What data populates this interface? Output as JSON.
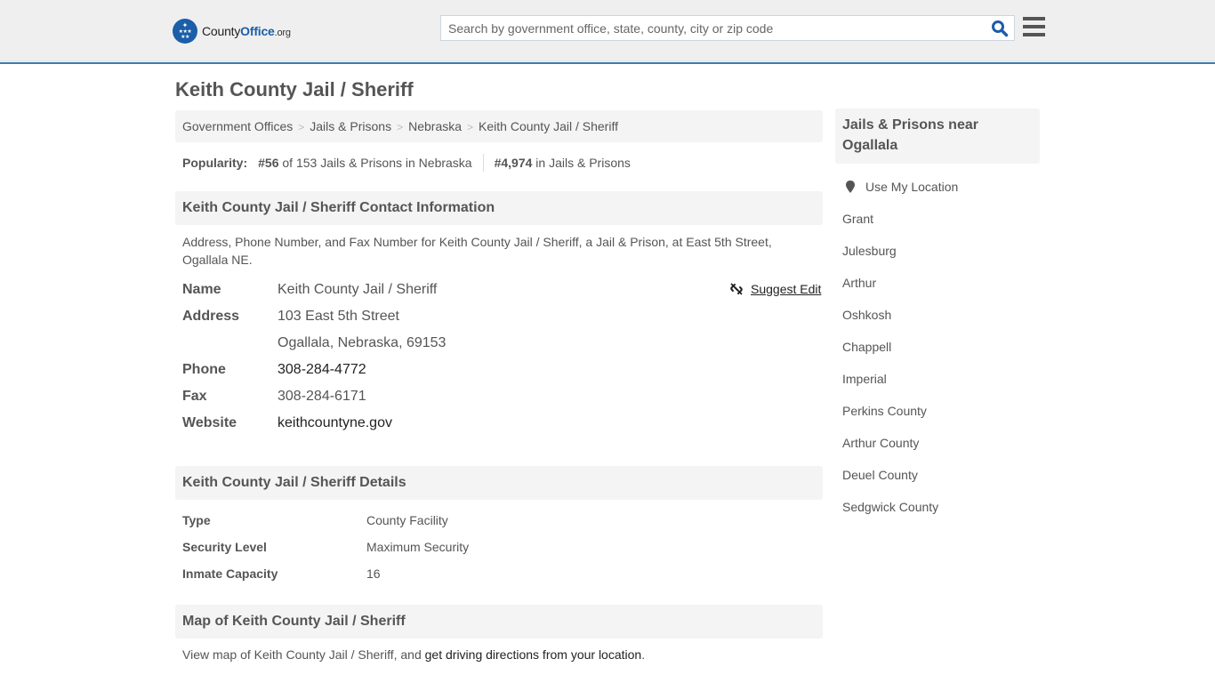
{
  "header": {
    "logo": {
      "county": "County",
      "office": "Office",
      "org": ".org"
    },
    "search_placeholder": "Search by government office, state, county, city or zip code",
    "search_value": "",
    "icons": {
      "search": "search-icon",
      "menu": "hamburger-menu-icon",
      "logo": "eagle-stars-badge-icon"
    },
    "brand_color": "#1b5ea9",
    "accent_border_color": "#3d7eaa"
  },
  "page_title": "Keith County Jail / Sheriff",
  "breadcrumb": [
    {
      "label": "Government Offices"
    },
    {
      "label": "Jails & Prisons"
    },
    {
      "label": "Nebraska"
    },
    {
      "label": "Keith County Jail / Sheriff"
    }
  ],
  "popularity": {
    "label": "Popularity:",
    "state_rank": "#56",
    "state_rank_text": " of 153 Jails & Prisons in Nebraska",
    "national_rank": "#4,974",
    "national_rank_text": " in Jails & Prisons"
  },
  "contact_section": {
    "heading": "Keith County Jail / Sheriff Contact Information",
    "description": "Address, Phone Number, and Fax Number for Keith County Jail / Sheriff, a Jail & Prison, at East 5th Street, Ogallala NE.",
    "suggest_edit": "Suggest Edit",
    "rows": {
      "name": {
        "label": "Name",
        "value": "Keith County Jail / Sheriff"
      },
      "address": {
        "label": "Address",
        "line1": "103 East 5th Street",
        "line2": "Ogallala, Nebraska, 69153"
      },
      "phone": {
        "label": "Phone",
        "value": "308-284-4772"
      },
      "fax": {
        "label": "Fax",
        "value": "308-284-6171"
      },
      "website": {
        "label": "Website",
        "value": "keithcountyne.gov"
      }
    }
  },
  "details_section": {
    "heading": "Keith County Jail / Sheriff Details",
    "rows": [
      {
        "label": "Type",
        "value": "County Facility"
      },
      {
        "label": "Security Level",
        "value": "Maximum Security"
      },
      {
        "label": "Inmate Capacity",
        "value": "16"
      }
    ]
  },
  "map_section": {
    "heading": "Map of Keith County Jail / Sheriff",
    "text_before": "View map of Keith County Jail / Sheriff, and ",
    "link": "get driving directions from your location",
    "text_after": "."
  },
  "sidebar": {
    "heading": "Jails & Prisons near Ogallala",
    "use_location": "Use My Location",
    "items": [
      "Grant",
      "Julesburg",
      "Arthur",
      "Oshkosh",
      "Chappell",
      "Imperial",
      "Perkins County",
      "Arthur County",
      "Deuel County",
      "Sedgwick County"
    ]
  }
}
